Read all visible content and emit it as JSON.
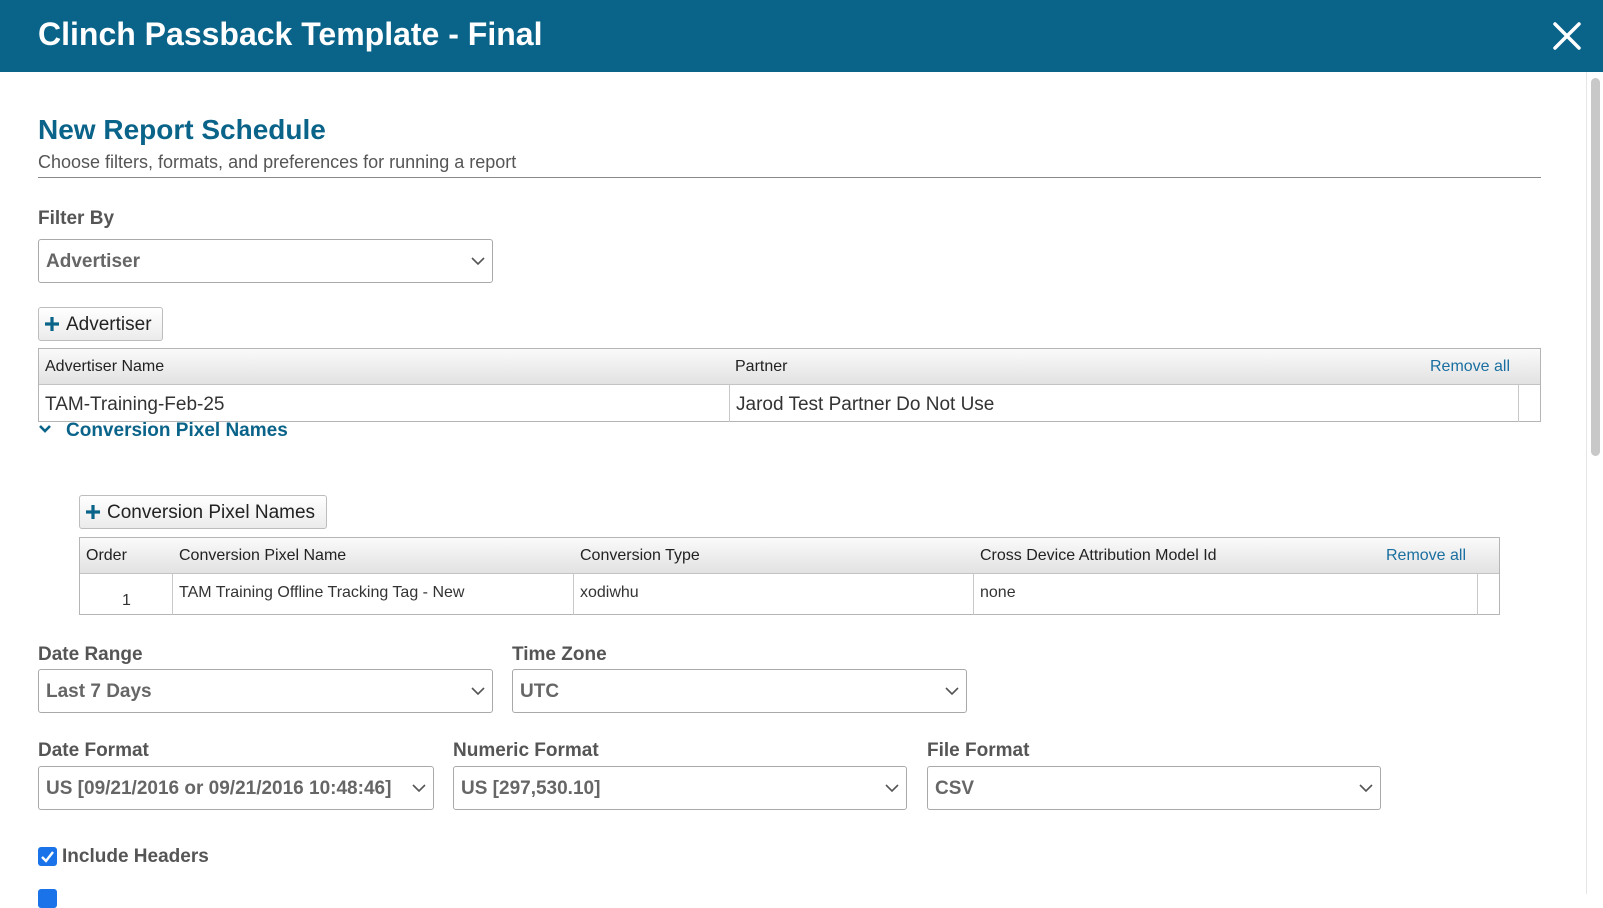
{
  "window": {
    "title": "Clinch Passback Template - Final"
  },
  "page": {
    "heading": "New Report Schedule",
    "subheading": "Choose filters, formats, and preferences for running a report"
  },
  "filter_by": {
    "label": "Filter By",
    "value": "Advertiser"
  },
  "advertiser_section": {
    "add_button_label": "Advertiser",
    "columns": {
      "name": "Advertiser Name",
      "partner": "Partner"
    },
    "remove_all_label": "Remove all",
    "rows": [
      {
        "name": "TAM-Training-Feb-25",
        "partner": "Jarod Test Partner Do Not Use"
      }
    ]
  },
  "conversion_section": {
    "toggle_label": "Conversion Pixel Names",
    "add_button_label": "Conversion Pixel Names",
    "columns": {
      "order": "Order",
      "name": "Conversion Pixel Name",
      "type": "Conversion Type",
      "model": "Cross Device Attribution Model Id"
    },
    "remove_all_label": "Remove all",
    "rows": [
      {
        "order": "1",
        "name": "TAM Training Offline Tracking Tag - New",
        "type": "xodiwhu",
        "model": "none"
      }
    ]
  },
  "date_range": {
    "label": "Date Range",
    "value": "Last 7 Days"
  },
  "time_zone": {
    "label": "Time Zone",
    "value": "UTC"
  },
  "date_format": {
    "label": "Date Format",
    "value": "US [09/21/2016 or 09/21/2016 10:48:46]"
  },
  "numeric_format": {
    "label": "Numeric Format",
    "value": "US [297,530.10]"
  },
  "file_format": {
    "label": "File Format",
    "value": "CSV"
  },
  "include_headers": {
    "label": "Include Headers",
    "checked": true
  },
  "colors": {
    "header_bar": "#0a6389",
    "accent_text": "#0a6389",
    "link": "#1a6fa0",
    "checkbox": "#1a73e8"
  }
}
